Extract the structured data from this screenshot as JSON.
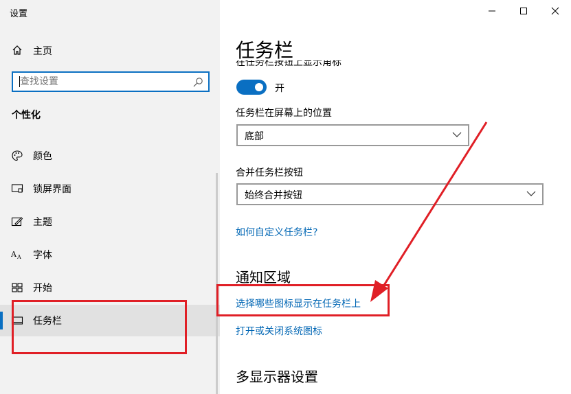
{
  "window": {
    "title": "设置"
  },
  "sidebar": {
    "home_label": "主页",
    "search_placeholder": "查找设置",
    "section_title": "个性化",
    "items": [
      {
        "label": "颜色",
        "icon": "palette-icon"
      },
      {
        "label": "锁屏界面",
        "icon": "lock-screen-icon"
      },
      {
        "label": "主题",
        "icon": "theme-brush-icon"
      },
      {
        "label": "字体",
        "icon": "font-icon"
      },
      {
        "label": "开始",
        "icon": "start-grid-icon"
      },
      {
        "label": "任务栏",
        "icon": "taskbar-icon",
        "active": true
      }
    ]
  },
  "main": {
    "title": "任务栏",
    "clipped_setting": "在任务栏按钮上显示角标",
    "toggle": {
      "state": "开",
      "on": true
    },
    "position": {
      "label": "任务栏在屏幕上的位置",
      "value": "底部"
    },
    "combine": {
      "label": "合并任务栏按钮",
      "value": "始终合并按钮"
    },
    "customize_link": "如何自定义任务栏?",
    "notification": {
      "title": "通知区域",
      "link_icons": "选择哪些图标显示在任务栏上",
      "link_system": "打开或关闭系统图标"
    },
    "multi_display_title": "多显示器设置"
  },
  "colors": {
    "accent": "#0a6fc2",
    "link": "#0066b4",
    "annotation": "#e01f26",
    "sidebar_bg": "#f2f2f2"
  }
}
